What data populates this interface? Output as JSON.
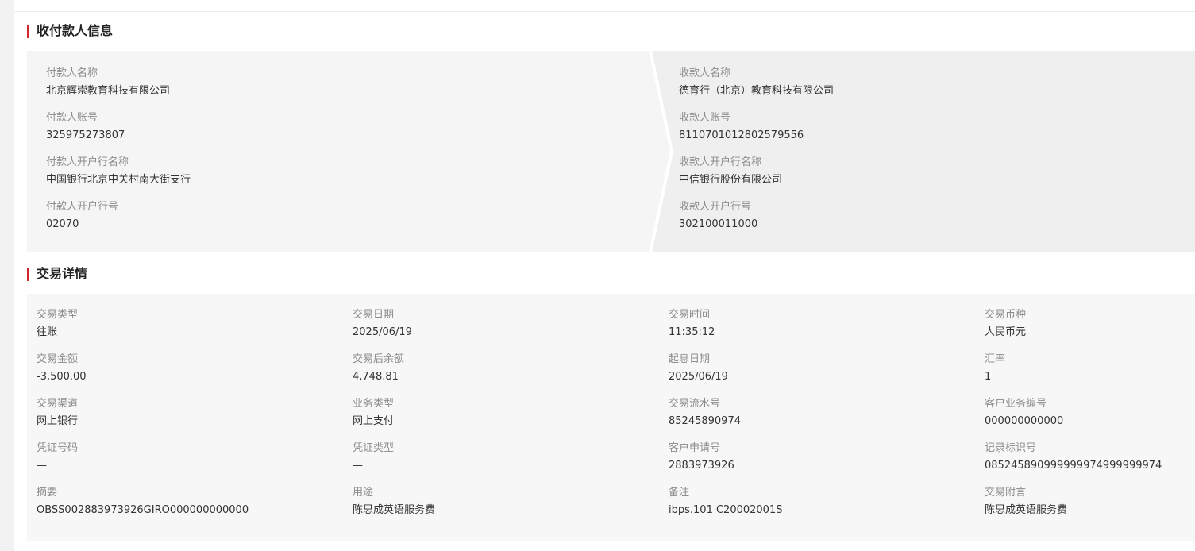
{
  "parties_section": {
    "title": "收付款人信息",
    "payer": [
      {
        "label": "付款人名称",
        "value": "北京辉崇教育科技有限公司"
      },
      {
        "label": "付款人账号",
        "value": "325975273807"
      },
      {
        "label": "付款人开户行名称",
        "value": "中国银行北京中关村南大街支行"
      },
      {
        "label": "付款人开户行号",
        "value": "02070"
      }
    ],
    "payee": [
      {
        "label": "收款人名称",
        "value": "德育行（北京）教育科技有限公司"
      },
      {
        "label": "收款人账号",
        "value": "8110701012802579556"
      },
      {
        "label": "收款人开户行名称",
        "value": "中信银行股份有限公司"
      },
      {
        "label": "收款人开户行号",
        "value": "302100011000"
      }
    ]
  },
  "details_section": {
    "title": "交易详情",
    "fields": [
      {
        "label": "交易类型",
        "value": "往账"
      },
      {
        "label": "交易日期",
        "value": "2025/06/19"
      },
      {
        "label": "交易时间",
        "value": "11:35:12"
      },
      {
        "label": "交易币种",
        "value": "人民币元"
      },
      {
        "label": "交易金额",
        "value": "-3,500.00"
      },
      {
        "label": "交易后余额",
        "value": "4,748.81"
      },
      {
        "label": "起息日期",
        "value": "2025/06/19"
      },
      {
        "label": "汇率",
        "value": "1"
      },
      {
        "label": "交易渠道",
        "value": "网上银行"
      },
      {
        "label": "业务类型",
        "value": "网上支付"
      },
      {
        "label": "交易流水号",
        "value": "85245890974"
      },
      {
        "label": "客户业务编号",
        "value": "000000000000"
      },
      {
        "label": "凭证号码",
        "value": "—"
      },
      {
        "label": "凭证类型",
        "value": "—"
      },
      {
        "label": "客户申请号",
        "value": "2883973926"
      },
      {
        "label": "记录标识号",
        "value": "085245890999999974999999974"
      },
      {
        "label": "摘要",
        "value": "OBSS002883973926GIRO000000000000"
      },
      {
        "label": "用途",
        "value": "陈思成英语服务费"
      },
      {
        "label": "备注",
        "value": "ibps.101 C20002001S"
      },
      {
        "label": "交易附言",
        "value": "陈思成英语服务费"
      }
    ]
  },
  "colors": {
    "accent": "#d3262b",
    "page_bg": "#f2f2f2",
    "card_bg": "#f7f7f7"
  }
}
